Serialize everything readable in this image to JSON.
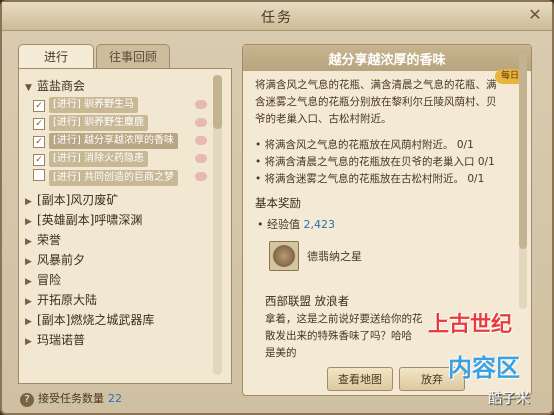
{
  "window": {
    "title": "任务"
  },
  "tabs": [
    {
      "label": "进行"
    },
    {
      "label": "往事回顾"
    }
  ],
  "quest_list": {
    "categories": [
      {
        "label": "蓝盐商会",
        "expanded": true
      },
      {
        "label": "[副本]风刃废矿"
      },
      {
        "label": "[英雄副本]呼啸深渊"
      },
      {
        "label": "荣誉"
      },
      {
        "label": "风暴前夕"
      },
      {
        "label": "冒险"
      },
      {
        "label": "开拓原大陆"
      },
      {
        "label": "[副本]燃烧之城武器库"
      },
      {
        "label": "玛瑞诺普"
      }
    ],
    "quests": [
      {
        "label": "[进行] 驯养野生马",
        "checked": true
      },
      {
        "label": "[进行] 驯养野生麋鹿",
        "checked": true
      },
      {
        "label": "[进行] 越分享越浓厚的香味",
        "checked": true,
        "selected": true
      },
      {
        "label": "[进行] 消除火药隐患",
        "checked": true
      },
      {
        "label": "[进行] 共同创造的巨商之梦",
        "checked": false
      }
    ]
  },
  "footer": {
    "label": "接受任务数量",
    "count": "22"
  },
  "detail": {
    "daily_badge": "每日",
    "title": "越分享越浓厚的香味",
    "description_lines": [
      "将满含风之气息的花瓶、满含清晨之气息的花瓶、满",
      "含迷雾之气息的花瓶分别放在黎利尔丘陵风荫村、贝",
      "爷的老巢入口、古松村附近。"
    ],
    "objectives": [
      "• 将满含风之气息的花瓶放在风荫村附近。 0/1",
      "• 将满含清晨之气息的花瓶放在贝爷的老巢入口 0/1",
      "• 将满含迷雾之气息的花瓶放在古松村附近。 0/1"
    ],
    "rewards_header": "基本奖励",
    "exp_label": "• 经验值",
    "exp_value": "2,423",
    "item_name": "德翡纳之星",
    "npc_name": "西部联盟 放浪者",
    "npc_lines": [
      "拿着，这是之前说好要送给你的花",
      "散发出来的特殊香味了吗？哈哈",
      "是美的"
    ],
    "btn_map": "查看地图",
    "btn_abandon": "放弃"
  },
  "watermark": {
    "line1": "上古世纪",
    "line2": "内容区",
    "line3": "酷子米"
  },
  "colors": {
    "accent_blue": "#2e6fb0",
    "panel_bg": "#f3e9d4",
    "title_bar": "#c8b48f"
  }
}
